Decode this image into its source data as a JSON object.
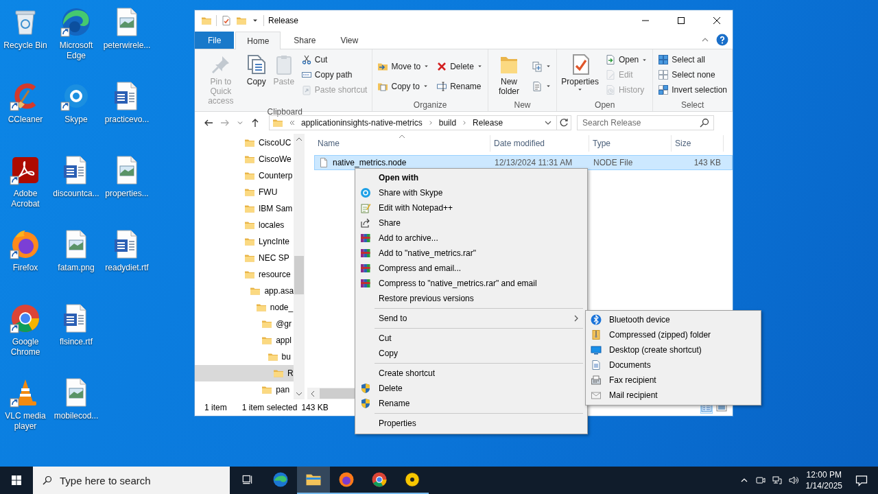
{
  "desktop": {
    "icons": [
      {
        "label": "Recycle Bin",
        "kind": "recycle-bin",
        "shortcut": false
      },
      {
        "label": "CCleaner",
        "kind": "ccleaner",
        "shortcut": true
      },
      {
        "label": "Adobe Acrobat",
        "kind": "acrobat",
        "shortcut": true
      },
      {
        "label": "Firefox",
        "kind": "firefox",
        "shortcut": true
      },
      {
        "label": "Google Chrome",
        "kind": "chrome",
        "shortcut": true
      },
      {
        "label": "VLC media player",
        "kind": "vlc",
        "shortcut": true
      },
      {
        "label": "Microsoft Edge",
        "kind": "edge",
        "shortcut": true
      },
      {
        "label": "Skype",
        "kind": "skype",
        "shortcut": true
      },
      {
        "label": "discountca...",
        "kind": "word",
        "shortcut": false
      },
      {
        "label": "fatam.png",
        "kind": "image",
        "shortcut": false
      },
      {
        "label": "flsince.rtf",
        "kind": "word",
        "shortcut": false
      },
      {
        "label": "mobilecod...",
        "kind": "image",
        "shortcut": false
      },
      {
        "label": "peterwirele...",
        "kind": "image",
        "shortcut": false
      },
      {
        "label": "practicevo...",
        "kind": "word",
        "shortcut": false
      },
      {
        "label": "properties...",
        "kind": "image",
        "shortcut": false
      },
      {
        "label": "readydiet.rtf",
        "kind": "word",
        "shortcut": false
      }
    ]
  },
  "explorer": {
    "title": "Release",
    "tabs": [
      {
        "label": "File",
        "kind": "menu",
        "selected": false
      },
      {
        "label": "Home",
        "kind": "tab",
        "selected": true
      },
      {
        "label": "Share",
        "kind": "tab",
        "selected": false
      },
      {
        "label": "View",
        "kind": "tab",
        "selected": false
      }
    ],
    "ribbon": {
      "groups": [
        {
          "label": "Clipboard",
          "commands": [
            {
              "label": "Pin to Quick access",
              "kind": "large",
              "disabled": true,
              "has_menu": false
            },
            {
              "label": "Copy",
              "kind": "large",
              "disabled": false,
              "has_menu": false
            },
            {
              "label": "Paste",
              "kind": "large",
              "disabled": true,
              "has_menu": false
            },
            {
              "label": "Cut",
              "kind": "small",
              "disabled": false,
              "has_menu": false
            },
            {
              "label": "Copy path",
              "kind": "small",
              "disabled": false,
              "has_menu": false
            },
            {
              "label": "Paste shortcut",
              "kind": "small",
              "disabled": true,
              "has_menu": false
            }
          ]
        },
        {
          "label": "Organize",
          "commands": [
            {
              "label": "Move to",
              "kind": "small",
              "disabled": false,
              "has_menu": true
            },
            {
              "label": "Copy to",
              "kind": "small",
              "disabled": false,
              "has_menu": true
            },
            {
              "label": "Delete",
              "kind": "small",
              "disabled": false,
              "has_menu": true
            },
            {
              "label": "Rename",
              "kind": "small",
              "disabled": false,
              "has_menu": false
            }
          ]
        },
        {
          "label": "New",
          "commands": [
            {
              "label": "New folder",
              "kind": "large",
              "disabled": false,
              "has_menu": false
            },
            {
              "kind": "icon",
              "disabled": false,
              "has_menu": true
            },
            {
              "kind": "icon",
              "disabled": false,
              "has_menu": true
            }
          ]
        },
        {
          "label": "Open",
          "commands": [
            {
              "label": "Properties",
              "kind": "large",
              "disabled": false,
              "has_menu": true
            },
            {
              "label": "Open",
              "kind": "small",
              "disabled": false,
              "has_menu": true
            },
            {
              "label": "Edit",
              "kind": "small",
              "disabled": true,
              "has_menu": false
            },
            {
              "label": "History",
              "kind": "small",
              "disabled": true,
              "has_menu": false
            }
          ]
        },
        {
          "label": "Select",
          "commands": [
            {
              "label": "Select all",
              "kind": "small",
              "disabled": false,
              "has_menu": false
            },
            {
              "label": "Select none",
              "kind": "small",
              "disabled": false,
              "has_menu": false
            },
            {
              "label": "Invert selection",
              "kind": "small",
              "disabled": false,
              "has_menu": false
            }
          ]
        }
      ]
    },
    "address": {
      "crumbs": [
        "applicationinsights-native-metrics",
        "build",
        "Release"
      ]
    },
    "search": {
      "placeholder": "Search Release"
    },
    "navigation": {
      "items": [
        {
          "label": "CiscoUC",
          "selected": false
        },
        {
          "label": "CiscoWe",
          "selected": false
        },
        {
          "label": "Counterp",
          "selected": false
        },
        {
          "label": "FWU",
          "selected": false
        },
        {
          "label": "IBM Sam",
          "selected": false
        },
        {
          "label": "locales",
          "selected": false
        },
        {
          "label": "LyncInte",
          "selected": false
        },
        {
          "label": "NEC SP",
          "selected": false
        },
        {
          "label": "resource",
          "selected": false,
          "children": [
            {
              "label": "app.asa",
              "selected": false,
              "children": [
                {
                  "label": "node_",
                  "selected": false,
                  "children": [
                    {
                      "label": "@gr",
                      "selected": false
                    },
                    {
                      "label": "appl",
                      "selected": false,
                      "children": [
                        {
                          "label": "bu",
                          "selected": false,
                          "children": [
                            {
                              "label": "R",
                              "selected": true
                            }
                          ]
                        }
                      ]
                    },
                    {
                      "label": "pan",
                      "selected": false
                    }
                  ]
                }
              ]
            }
          ]
        }
      ]
    },
    "columns": [
      {
        "label": "Name",
        "sorted": true
      },
      {
        "label": "Date modified",
        "sorted": false
      },
      {
        "label": "Type",
        "sorted": false
      },
      {
        "label": "Size",
        "sorted": false
      }
    ],
    "rows": [
      {
        "name": "native_metrics.node",
        "date": "12/13/2024 11:31 AM",
        "type": "NODE File",
        "size": "143 KB",
        "selected": true
      }
    ],
    "status": [
      "1 item",
      "1 item selected",
      "143 KB"
    ]
  },
  "context_menu": {
    "sections": [
      {
        "items": [
          {
            "label": "Open with",
            "default": true,
            "has_submenu": false
          },
          {
            "label": "Share with Skype",
            "default": false,
            "has_submenu": false
          },
          {
            "label": "Edit with Notepad++",
            "default": false,
            "has_submenu": false
          },
          {
            "label": "Share",
            "default": false,
            "has_submenu": false
          },
          {
            "label": "Add to archive...",
            "default": false,
            "has_submenu": false
          },
          {
            "label": "Add to \"native_metrics.rar\"",
            "default": false,
            "has_submenu": false
          },
          {
            "label": "Compress and email...",
            "default": false,
            "has_submenu": false
          },
          {
            "label": "Compress to \"native_metrics.rar\" and email",
            "default": false,
            "has_submenu": false
          },
          {
            "label": "Restore previous versions",
            "default": false,
            "has_submenu": false
          }
        ]
      },
      {
        "items": [
          {
            "label": "Send to",
            "default": false,
            "has_submenu": true
          }
        ]
      },
      {
        "items": [
          {
            "label": "Cut",
            "default": false,
            "has_submenu": false
          },
          {
            "label": "Copy",
            "default": false,
            "has_submenu": false
          }
        ]
      },
      {
        "items": [
          {
            "label": "Create shortcut",
            "default": false,
            "has_submenu": false
          },
          {
            "label": "Delete",
            "default": false,
            "has_submenu": false
          },
          {
            "label": "Rename",
            "default": false,
            "has_submenu": false
          }
        ]
      },
      {
        "items": [
          {
            "label": "Properties",
            "default": false,
            "has_submenu": false
          }
        ]
      }
    ]
  },
  "send_to_menu": {
    "items": [
      "Bluetooth device",
      "Compressed (zipped) folder",
      "Desktop (create shortcut)",
      "Documents",
      "Fax recipient",
      "Mail recipient"
    ]
  },
  "taskbar": {
    "search": {
      "placeholder": "Type here to search"
    },
    "apps": [
      {
        "kind": "edge",
        "running": false,
        "selected": false
      },
      {
        "kind": "explorer",
        "running": true,
        "selected": true
      },
      {
        "kind": "firefox",
        "running": true,
        "selected": false
      },
      {
        "kind": "chrome",
        "running": true,
        "selected": false
      },
      {
        "kind": "japp",
        "running": true,
        "selected": false
      }
    ],
    "clock": {
      "time": "12:00 PM",
      "date": "1/14/2025"
    }
  }
}
